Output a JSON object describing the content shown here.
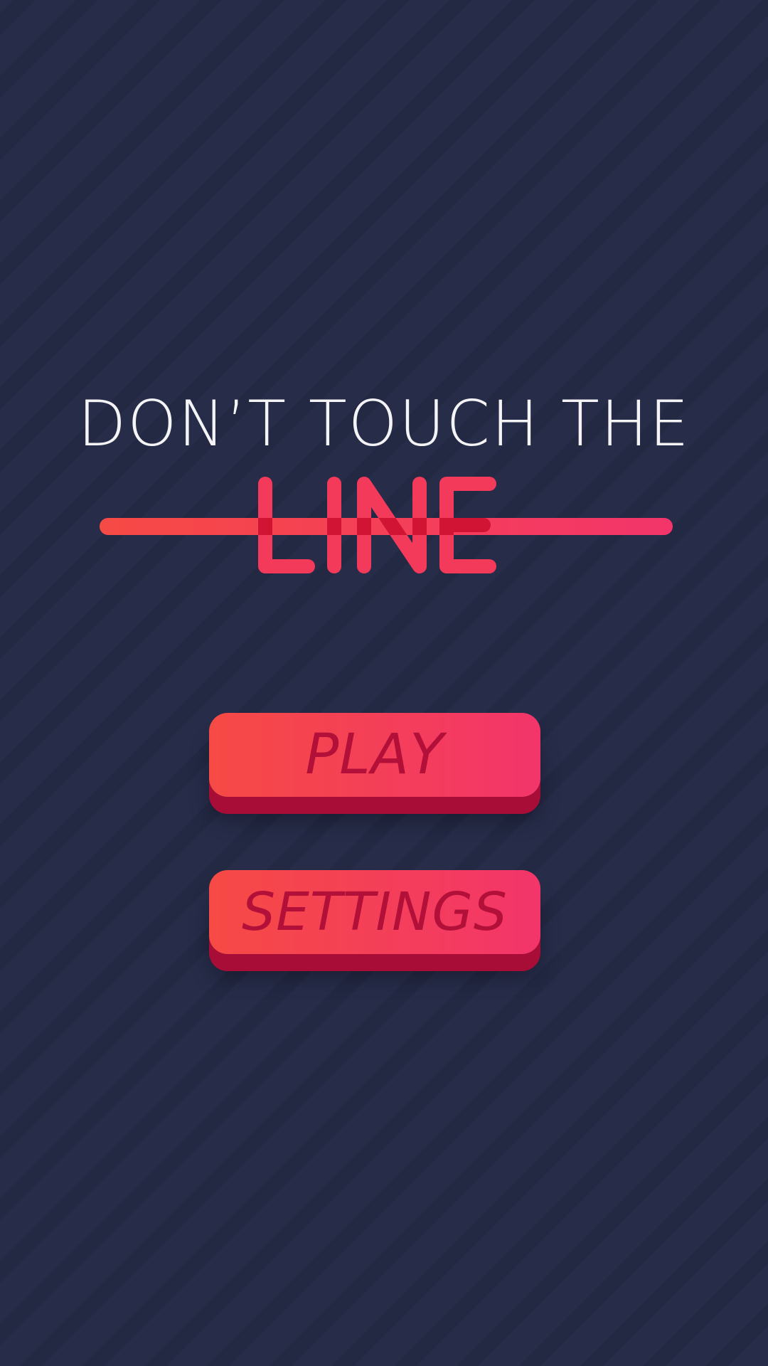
{
  "title": {
    "top_text": "DON’T TOUCH THE",
    "line_word": "LINE"
  },
  "menu": {
    "play_label": "PLAY",
    "settings_label": "SETTINGS"
  },
  "colors": {
    "background": "#272c49",
    "background_stripe": "#232843",
    "title_text": "#f4f4f6",
    "accent_start": "#f64a45",
    "accent_end": "#f3356a",
    "button_shadow": "#a80d37",
    "button_text": "#b21039",
    "overlap": "#d21434"
  }
}
